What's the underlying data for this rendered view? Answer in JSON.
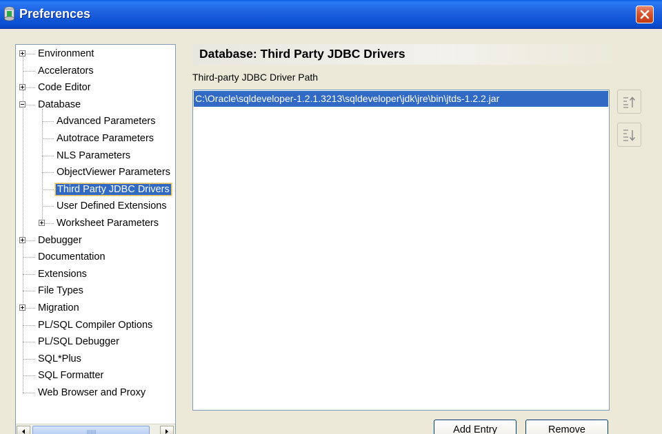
{
  "window": {
    "title": "Preferences"
  },
  "tree": {
    "items": [
      {
        "label": "Environment",
        "level": 0,
        "expander": "plus"
      },
      {
        "label": "Accelerators",
        "level": 0,
        "expander": "none"
      },
      {
        "label": "Code Editor",
        "level": 0,
        "expander": "plus"
      },
      {
        "label": "Database",
        "level": 0,
        "expander": "minus"
      },
      {
        "label": "Advanced Parameters",
        "level": 1,
        "expander": "none"
      },
      {
        "label": "Autotrace Parameters",
        "level": 1,
        "expander": "none"
      },
      {
        "label": "NLS Parameters",
        "level": 1,
        "expander": "none"
      },
      {
        "label": "ObjectViewer Parameters",
        "level": 1,
        "expander": "none"
      },
      {
        "label": "Third Party JDBC Drivers",
        "level": 1,
        "expander": "none",
        "selected": true
      },
      {
        "label": "User Defined Extensions",
        "level": 1,
        "expander": "none"
      },
      {
        "label": "Worksheet Parameters",
        "level": 1,
        "expander": "plus"
      },
      {
        "label": "Debugger",
        "level": 0,
        "expander": "plus"
      },
      {
        "label": "Documentation",
        "level": 0,
        "expander": "none"
      },
      {
        "label": "Extensions",
        "level": 0,
        "expander": "none"
      },
      {
        "label": "File Types",
        "level": 0,
        "expander": "none"
      },
      {
        "label": "Migration",
        "level": 0,
        "expander": "plus"
      },
      {
        "label": "PL/SQL Compiler Options",
        "level": 0,
        "expander": "none"
      },
      {
        "label": "PL/SQL Debugger",
        "level": 0,
        "expander": "none"
      },
      {
        "label": "SQL*Plus",
        "level": 0,
        "expander": "none"
      },
      {
        "label": "SQL Formatter",
        "level": 0,
        "expander": "none"
      },
      {
        "label": "Web Browser and Proxy",
        "level": 0,
        "expander": "none"
      }
    ]
  },
  "panel": {
    "title": "Database: Third Party JDBC Drivers",
    "path_label": "Third-party JDBC Driver Path",
    "entries": [
      "C:\\Oracle\\sqldeveloper-1.2.1.3213\\sqldeveloper\\jdk\\jre\\bin\\jtds-1.2.2.jar"
    ],
    "move_up_icon": "move-up-icon",
    "move_down_icon": "move-down-icon",
    "add_label": "Add Entry",
    "remove_label": "Remove"
  },
  "colors": {
    "selection": "#316ac5",
    "titlebar": "#0a4fd2",
    "close": "#d9542c"
  }
}
